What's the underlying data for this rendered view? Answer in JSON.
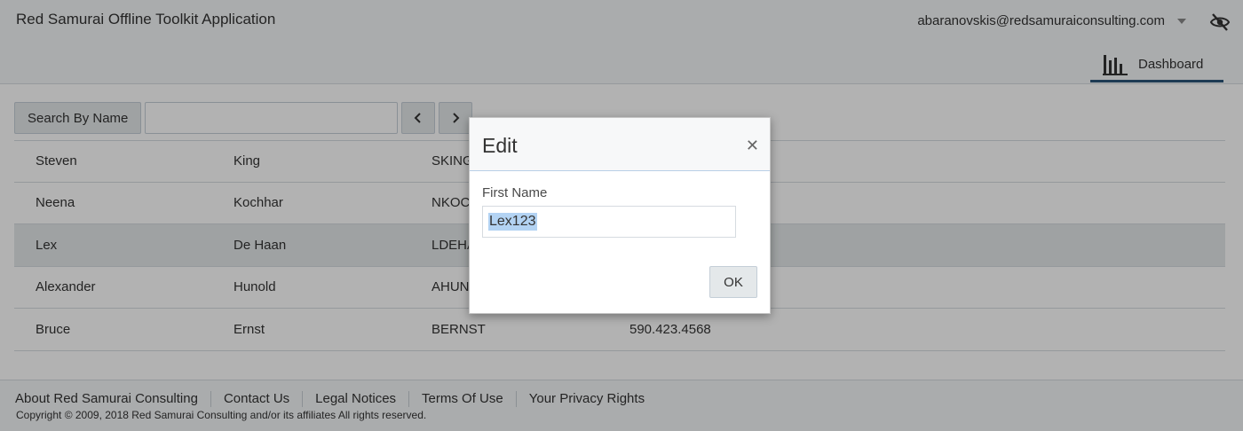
{
  "header": {
    "title": "Red Samurai Offline Toolkit Application",
    "user_email": "abaranovskis@redsamuraiconsulting.com",
    "nav_tab": "Dashboard"
  },
  "toolbar": {
    "search_button": "Search By Name",
    "search_value": "",
    "prev_icon": "chevron-left-icon",
    "next_icon": "chevron-right-icon"
  },
  "table": {
    "rows": [
      [
        "Steven",
        "King",
        "SKING",
        ""
      ],
      [
        "Neena",
        "Kochhar",
        "NKOCHHAR",
        ""
      ],
      [
        "Lex",
        "De Haan",
        "LDEHAAN",
        ""
      ],
      [
        "Alexander",
        "Hunold",
        "AHUNOLD",
        ""
      ],
      [
        "Bruce",
        "Ernst",
        "BERNST",
        "590.423.4568"
      ]
    ],
    "selected_row": 2
  },
  "dialog": {
    "title": "Edit",
    "field_label": "First Name",
    "field_value": "Lex123",
    "ok_label": "OK",
    "close_icon": "close-icon"
  },
  "footer": {
    "links": [
      "About Red Samurai Consulting",
      "Contact Us",
      "Legal Notices",
      "Terms Of Use",
      "Your Privacy Rights"
    ],
    "copyright": "Copyright © 2009, 2018 Red Samurai Consulting and/or its affiliates All rights reserved."
  },
  "colors": {
    "accent": "#2b5579",
    "selection": "#b3d3f3"
  }
}
